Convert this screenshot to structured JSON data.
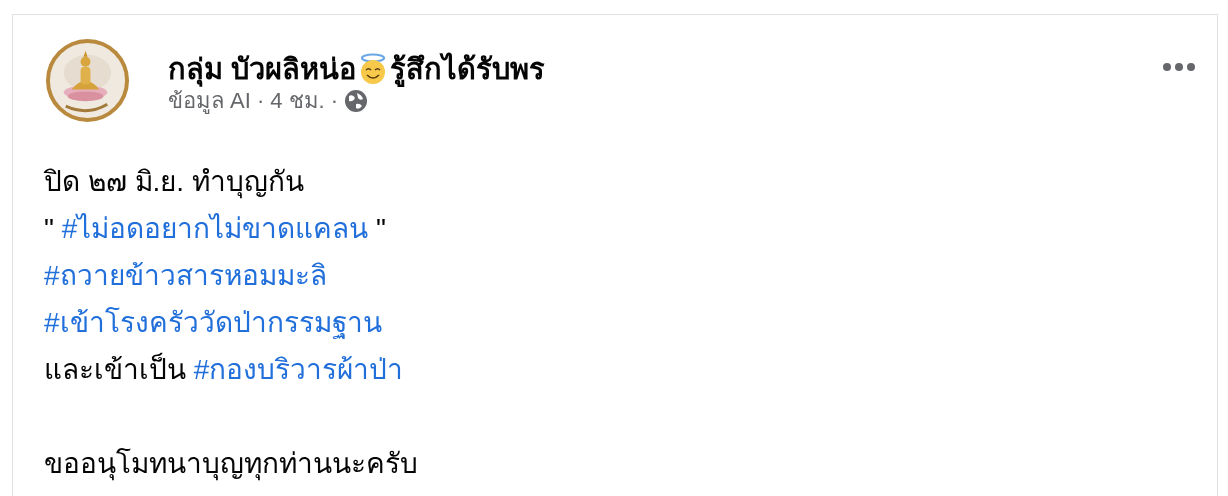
{
  "post": {
    "author": "กลุ่ม บัวผลิหน่อ",
    "activity": "รู้สึกได้รับพร",
    "meta": [
      "ข้อมูล AI",
      "·",
      "4 ชม.",
      "·"
    ],
    "paragraphs": [
      {
        "lines": [
          [
            {
              "kind": "text",
              "text": "ปิด ๒๗ มิ.ย. ทำบุญกัน"
            }
          ],
          [
            {
              "kind": "text",
              "text": "\" "
            },
            {
              "kind": "hashtag",
              "text": "#ไม่อดอยากไม่ขาดแคลน"
            },
            {
              "kind": "text",
              "text": " \""
            }
          ],
          [
            {
              "kind": "hashtag",
              "text": "#ถวายข้าวสารหอมมะลิ"
            }
          ],
          [
            {
              "kind": "hashtag",
              "text": "#เข้าโรงครัววัดป่ากรรมฐาน"
            }
          ],
          [
            {
              "kind": "text",
              "text": "และเข้าเป็น "
            },
            {
              "kind": "hashtag",
              "text": "#กองบริวารผ้าป่า"
            }
          ]
        ]
      },
      {
        "lines": [
          [
            {
              "kind": "text",
              "text": "ขออนุโมทนาบุญทุกท่านนะครับ"
            }
          ]
        ]
      }
    ]
  }
}
